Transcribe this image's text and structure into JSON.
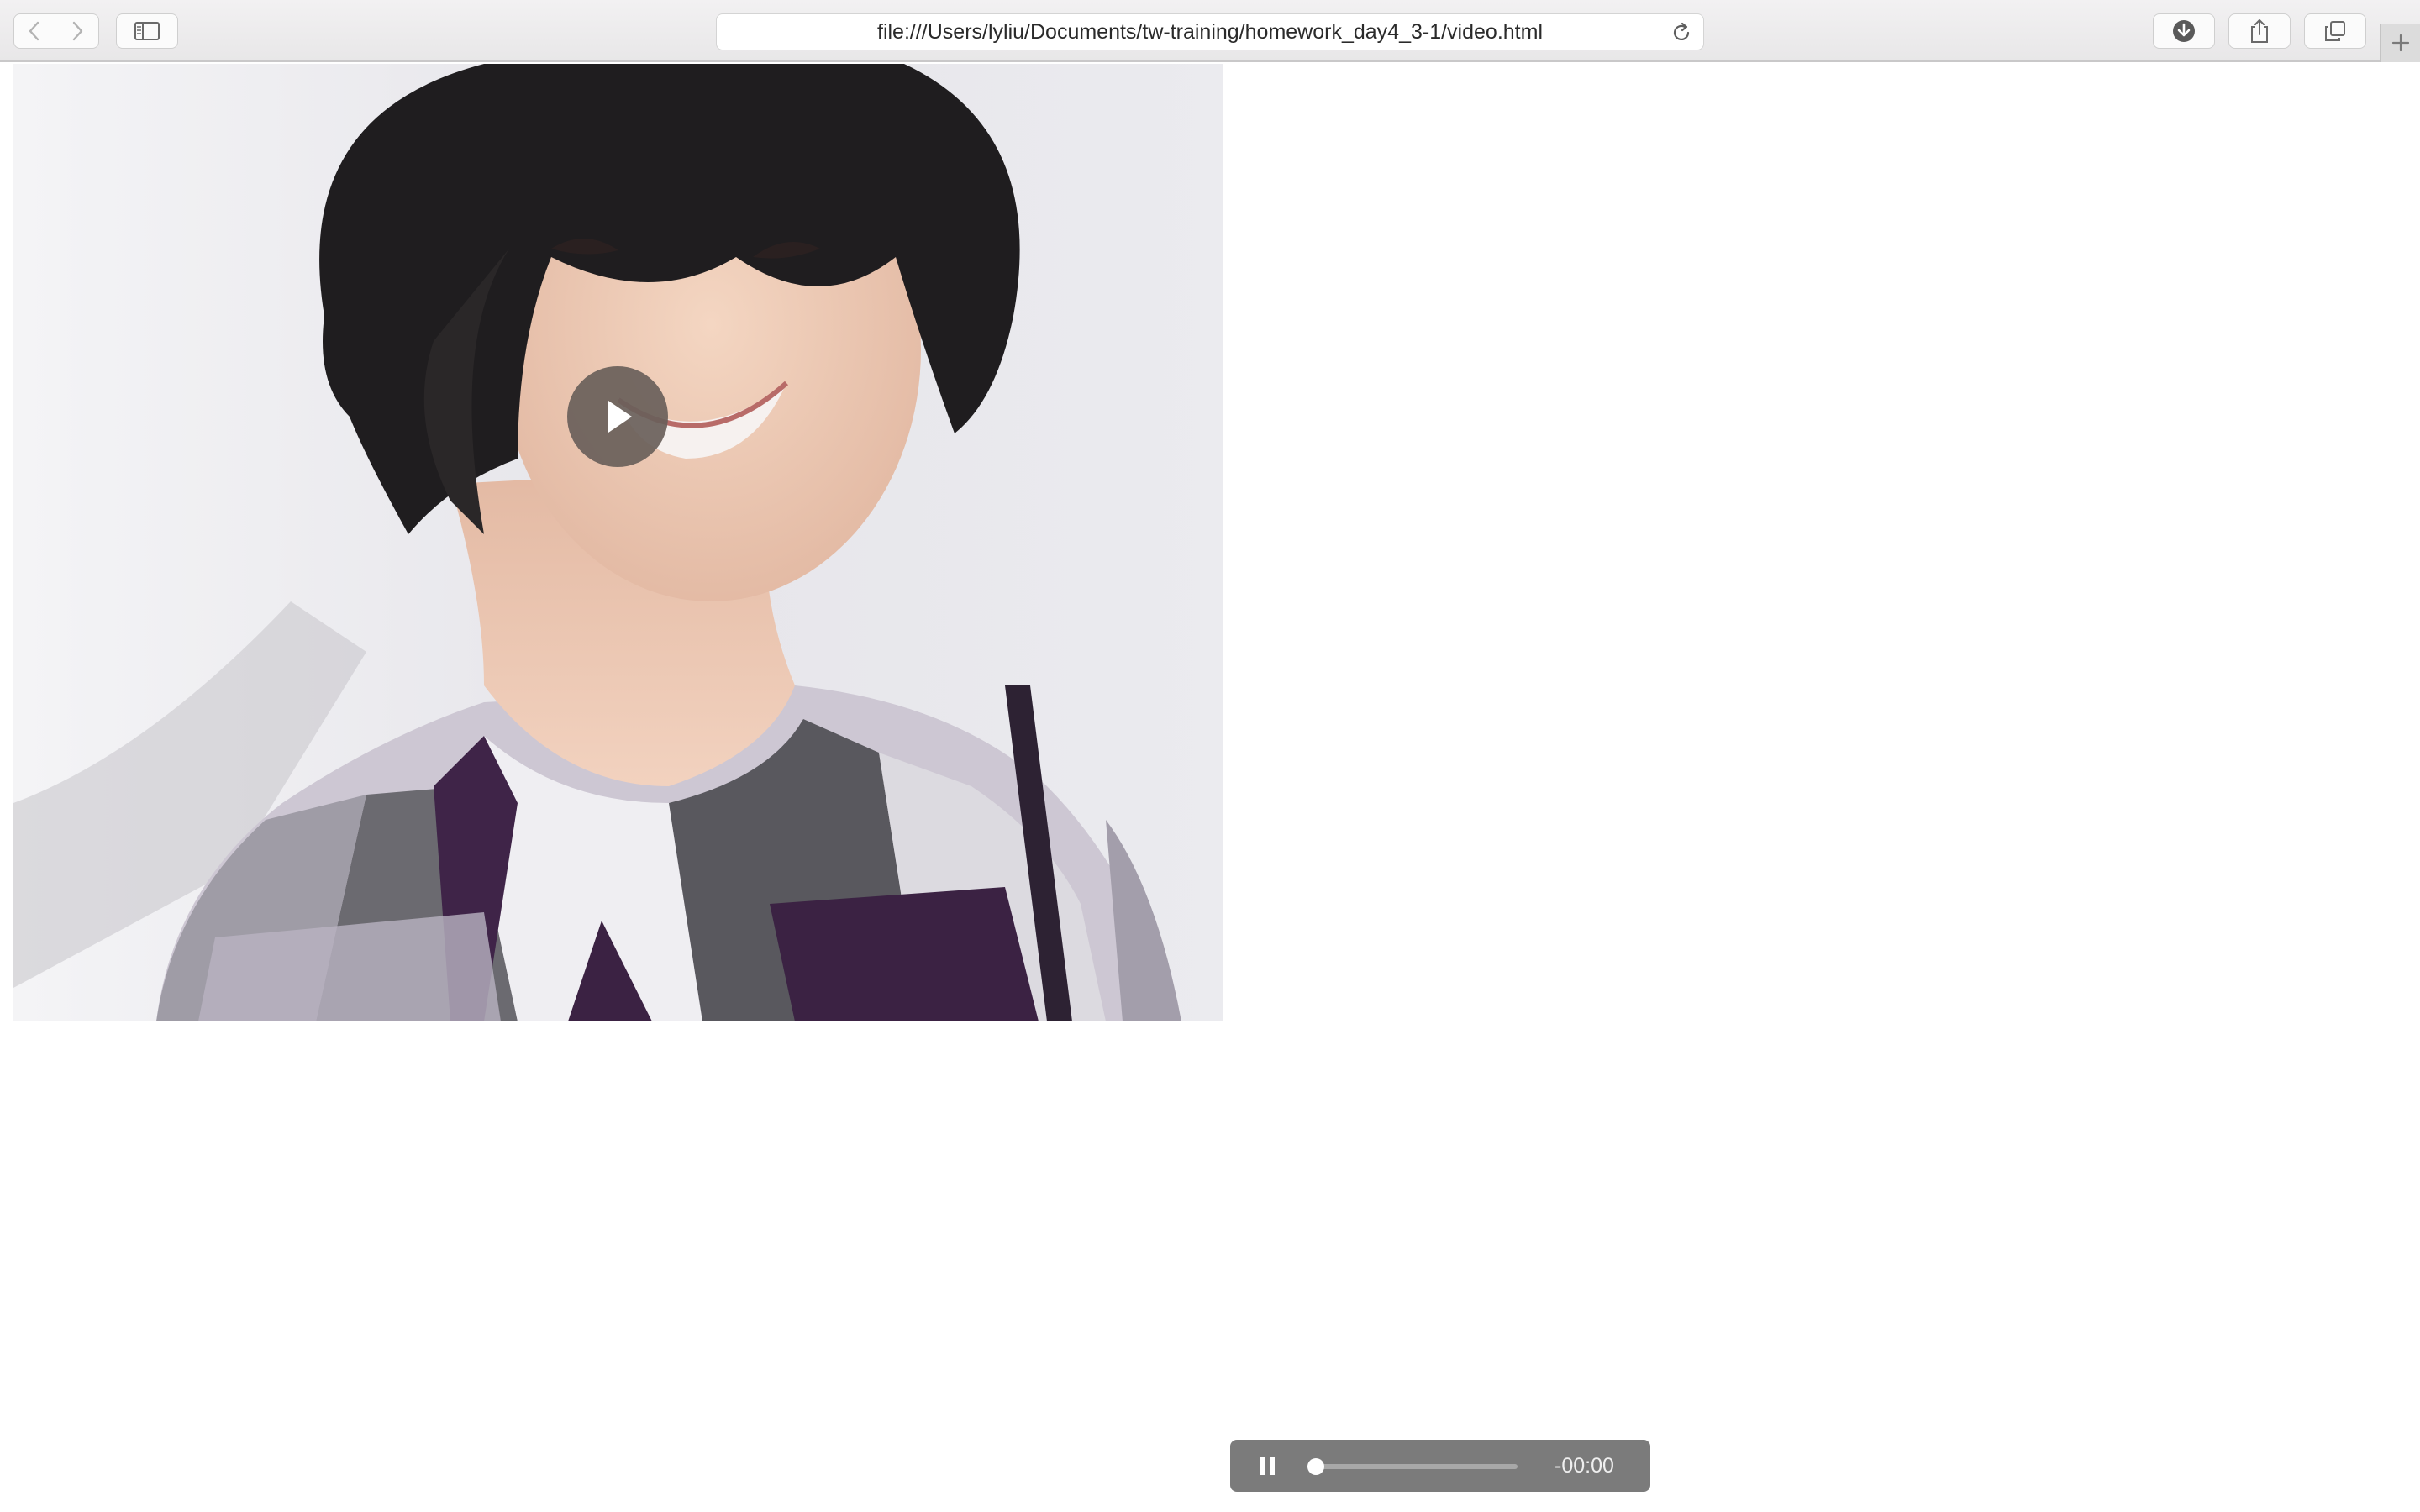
{
  "browser": {
    "url": "file:///Users/lyliu/Documents/tw-training/homework_day4_3-1/video.html",
    "icons": {
      "back": "chevron-left-icon",
      "forward": "chevron-right-icon",
      "sidebar": "sidebar-icon",
      "reload": "reload-icon",
      "download": "download-icon",
      "share": "share-icon",
      "tabs": "tab-overview-icon",
      "new_tab": "plus-icon"
    }
  },
  "video": {
    "poster_description_icon": "video-poster",
    "play_icon": "play-icon"
  },
  "audio": {
    "pause_icon": "pause-icon",
    "time_remaining": "-00:00",
    "progress": 0.0
  },
  "colors": {
    "toolbar_bg": "#ecebec",
    "audio_bg": "#7b7b7b",
    "play_button_bg": "#6b625d"
  }
}
